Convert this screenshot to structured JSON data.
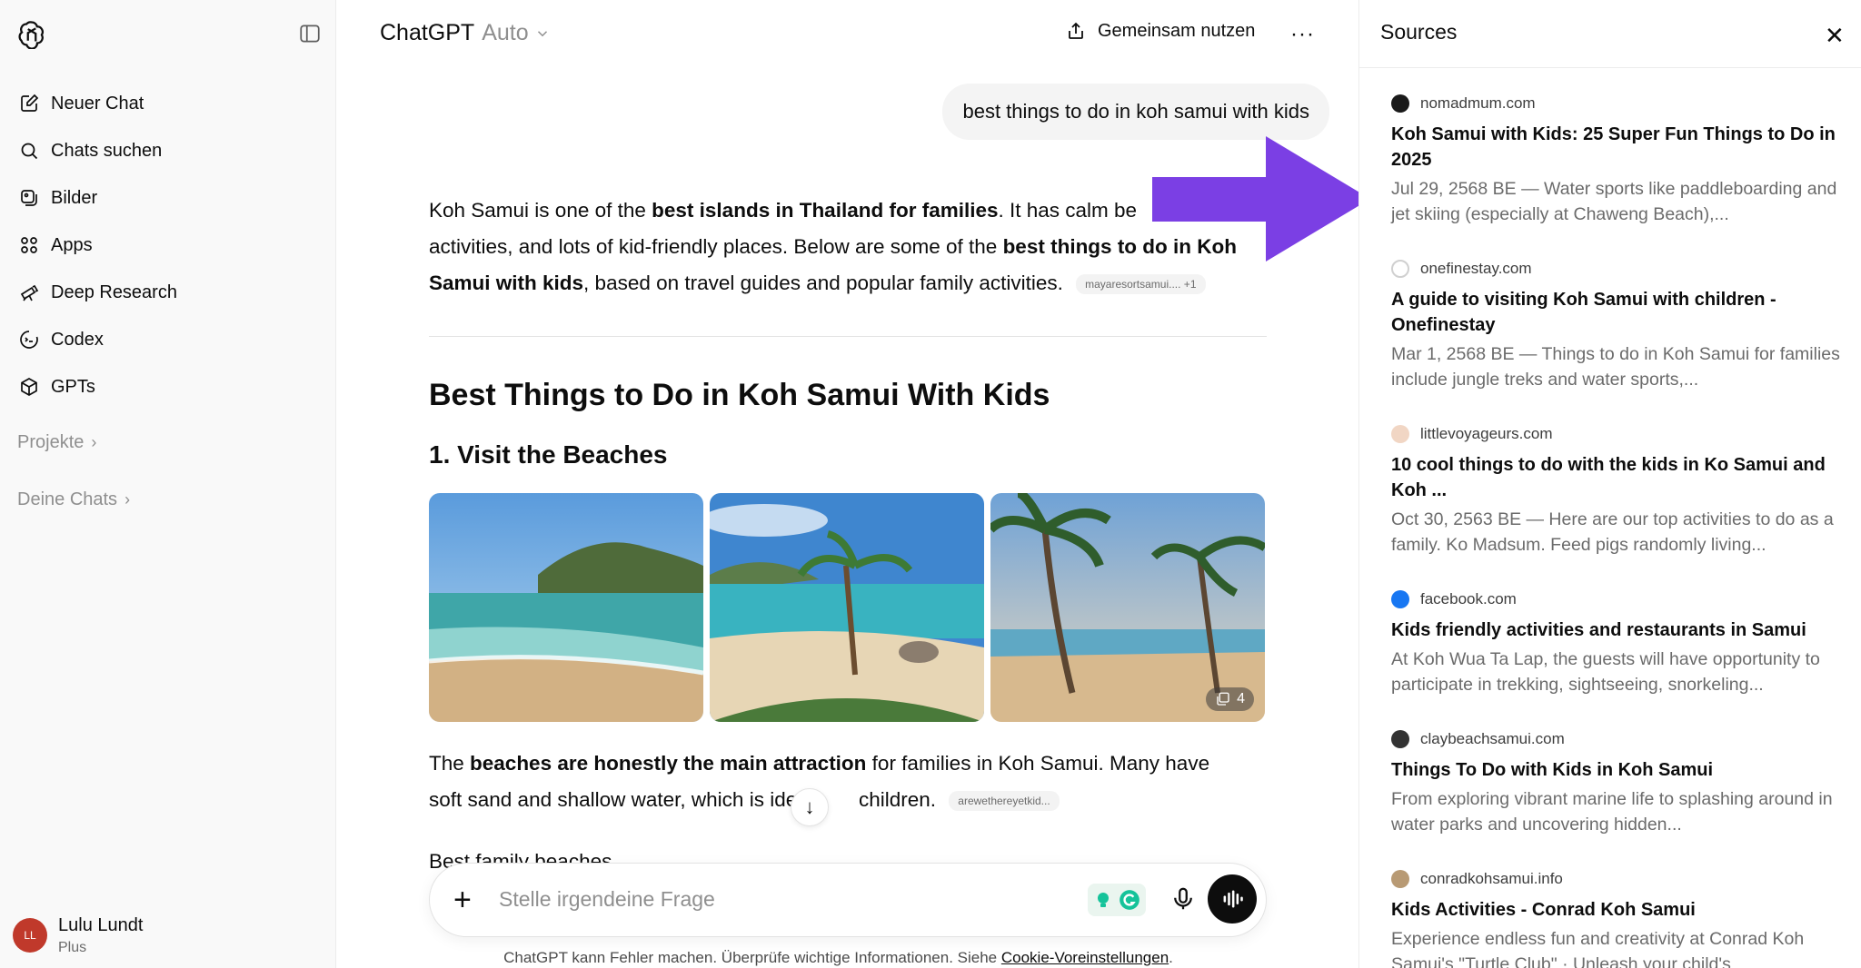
{
  "sidebar": {
    "nav": [
      {
        "label": "Neuer Chat",
        "icon": "edit-icon"
      },
      {
        "label": "Chats suchen",
        "icon": "search-icon"
      },
      {
        "label": "Bilder",
        "icon": "image-icon"
      },
      {
        "label": "Apps",
        "icon": "apps-icon"
      },
      {
        "label": "Deep Research",
        "icon": "telescope-icon"
      },
      {
        "label": "Codex",
        "icon": "codex-icon"
      },
      {
        "label": "GPTs",
        "icon": "cube-icon"
      }
    ],
    "projects_label": "Projekte",
    "chats_label": "Deine Chats",
    "user": {
      "initials": "LL",
      "name": "Lulu Lundt",
      "plan": "Plus"
    }
  },
  "header": {
    "title": "ChatGPT",
    "model": "Auto",
    "share_label": "Gemeinsam nutzen",
    "more": "···"
  },
  "chat": {
    "user_message": "best things to do in koh samui with kids",
    "intro": {
      "t1": "Koh Samui is one of the ",
      "b1": "best islands in Thailand for families",
      "t2": ". It has calm be",
      "t3": "activities, and lots of kid-friendly places. Below are some of the ",
      "b2": "best things to do in Koh",
      "b3": "Samui with kids",
      "t4": ", based on travel guides and popular family activities.",
      "cite": "mayaresortsamui.... +1"
    },
    "heading1": "Best Things to Do in Koh Samui With Kids",
    "heading2": "1. Visit the Beaches",
    "image_count": "4",
    "para2": {
      "t1": "The ",
      "b1": "beaches are honestly the main attraction",
      "t2": " for families in Koh Samui. Many have",
      "t3": "soft sand and shallow water, which is ideal",
      "t4": " children.",
      "cite": "arewethereyetkid..."
    },
    "partial_text": "Best family beaches"
  },
  "composer": {
    "placeholder": "Stelle irgendeine Frage"
  },
  "footer": {
    "text": "ChatGPT kann Fehler machen. Überprüfe wichtige Informationen. Siehe ",
    "link": "Cookie-Voreinstellungen",
    "end": "."
  },
  "sources_panel": {
    "title": "Sources",
    "items": [
      {
        "site": "nomadmum.com",
        "title": "Koh Samui with Kids: 25 Super Fun Things to Do in 2025",
        "snippet": "Jul 29, 2568 BE — Water sports like paddleboarding and jet skiing (especially at Chaweng Beach),...",
        "favicon_color": "#1a1a1a"
      },
      {
        "site": "onefinestay.com",
        "title": "A guide to visiting Koh Samui with children - Onefinestay",
        "snippet": "Mar 1, 2568 BE — Things to do in Koh Samui for families include jungle treks and water sports,...",
        "favicon_color": "#d9d9d9"
      },
      {
        "site": "littlevoyageurs.com",
        "title": "10 cool things to do with the kids in Ko Samui and Koh ...",
        "snippet": "Oct 30, 2563 BE — Here are our top activities to do as a family. Ko Madsum. Feed pigs randomly living...",
        "favicon_color": "#f1d6c4"
      },
      {
        "site": "facebook.com",
        "title": "Kids friendly activities and restaurants in Samui",
        "snippet": "At Koh Wua Ta Lap, the guests will have opportunity to participate in trekking, sightseeing, snorkeling...",
        "favicon_color": "#1877f2"
      },
      {
        "site": "claybeachsamui.com",
        "title": "Things To Do with Kids in Koh Samui",
        "snippet": "From exploring vibrant marine life to splashing around in water parks and uncovering hidden...",
        "favicon_color": "#333333"
      },
      {
        "site": "conradkohsamui.info",
        "title": "Kids Activities - Conrad Koh Samui",
        "snippet": "Experience endless fun and creativity at Conrad Koh Samui's \"Turtle Club\" · Unleash your child's",
        "favicon_color": "#b89a74"
      }
    ]
  },
  "colors": {
    "accent_arrow": "#7b3fe4",
    "avatar": "#c0392b"
  }
}
